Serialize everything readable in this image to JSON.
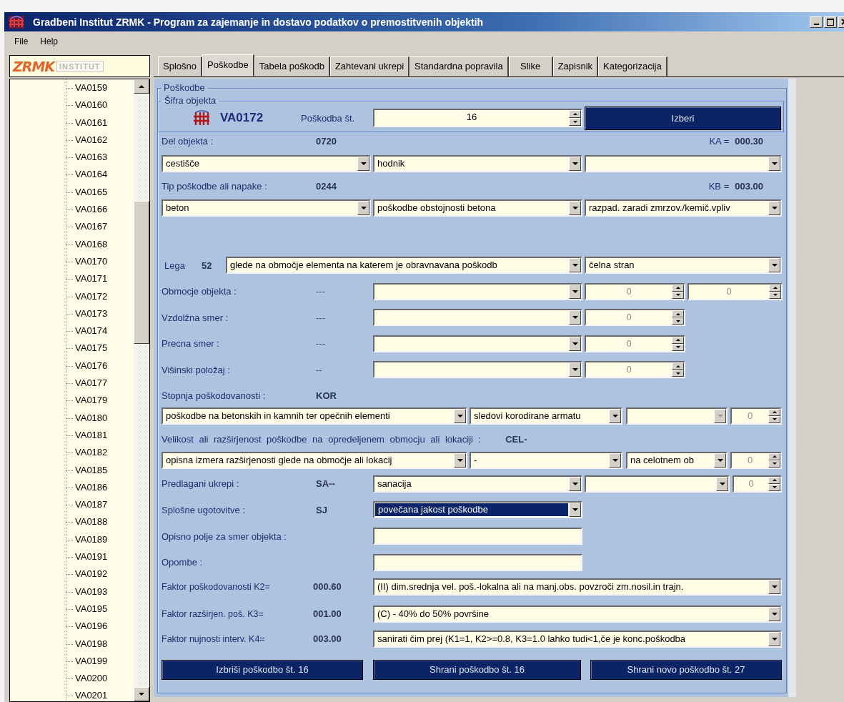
{
  "window": {
    "title": "Gradbeni Institut ZRMK - Program za zajemanje in dostavo podatkov o premostitvenih objektih"
  },
  "menu": [
    "File",
    "Help"
  ],
  "logo": {
    "mark": "ZRMK",
    "text": "INSTITUT"
  },
  "tree": {
    "items": [
      "VA0159",
      "VA0160",
      "VA0161",
      "VA0162",
      "VA0163",
      "VA0164",
      "VA0165",
      "VA0166",
      "VA0167",
      "VA0168",
      "VA0170",
      "VA0171",
      "VA0172",
      "VA0173",
      "VA0174",
      "VA0175",
      "VA0176",
      "VA0177",
      "VA0179",
      "VA0180",
      "VA0181",
      "VA0182",
      "VA0185",
      "VA0186",
      "VA0187",
      "VA0188",
      "VA0189",
      "VA0191",
      "VA0192",
      "VA0193",
      "VA0195",
      "VA0196",
      "VA0198",
      "VA0199",
      "VA0200",
      "VA0201"
    ]
  },
  "tabs": [
    {
      "label": "Splošno",
      "selected": false
    },
    {
      "label": "Poškodbe",
      "selected": true
    },
    {
      "label": "Tabela poškodb",
      "selected": false
    },
    {
      "label": "Zahtevani ukrepi",
      "selected": false
    },
    {
      "label": "Standardna popravila",
      "selected": false
    },
    {
      "label": "Slike",
      "selected": false
    },
    {
      "label": "Zapisnik",
      "selected": false
    },
    {
      "label": "Kategorizacija",
      "selected": false
    }
  ],
  "form": {
    "title": "Poškodbe",
    "object": {
      "title": "Šifra objekta",
      "code": "VA0172",
      "number_label": "Poškodba št.",
      "number": "16",
      "button": "Izberi"
    },
    "object_part": {
      "label": "Del objekta :",
      "code": "0720",
      "factor_label": "KA =",
      "factor_value": "000.30",
      "combos": [
        {
          "value": "cestišče"
        },
        {
          "value": "hodnik"
        }
      ]
    },
    "damage_type": {
      "label": "Tip poškodbe ali napake :",
      "code": "0244",
      "factor_label": "KB =",
      "factor_value": "003.00",
      "combos": [
        {
          "value": "beton"
        },
        {
          "value": "poškodbe obstojnosti betona"
        },
        {
          "value": "razpad. zaradi zmrzov./kemič.vpliv"
        }
      ]
    },
    "position": {
      "label": "Lega",
      "code": "52",
      "combos": [
        {
          "value": "glede na območje elementa na katerem je obravnavana poškodb"
        },
        {
          "value": "čelna stran"
        }
      ]
    },
    "location_rows": [
      {
        "label": "Obmocje objekta :",
        "code": "---",
        "spins": [
          "0",
          "0"
        ]
      },
      {
        "label": "Vzdolžna smer :",
        "code": "---",
        "spins": [
          "0"
        ]
      },
      {
        "label": "Precna smer :",
        "code": "---",
        "spins": [
          "0"
        ]
      },
      {
        "label": "Višinski položaj :",
        "code": "--",
        "spins": [
          "0"
        ]
      }
    ],
    "severity": {
      "label": "Stopnja poškodovanosti :",
      "code": "KOR",
      "combos": [
        {
          "value": "poškodbe na betonskih in kamnih ter opečnih elementi",
          "disabled": false
        },
        {
          "value": "sledovi korodirane armatu",
          "disabled": false
        },
        {
          "disabled": true
        }
      ],
      "spin": "0"
    },
    "extent": {
      "label": "Velikost ali razširjenost poškodbe na opredeljenem obmocju ali lokaciji :",
      "code": "CEL-",
      "combos": [
        {
          "value": "opisna izmera razširjenosti glede na območje ali lokacij",
          "disabled": false
        },
        {
          "value": "-",
          "disabled": false
        },
        {
          "value": "na celotnem ob",
          "disabled": false
        }
      ],
      "spin": "0"
    },
    "measures": {
      "label": "Predlagani ukrepi :",
      "code": "SA--",
      "combos": [
        {
          "value": "sanacija"
        }
      ],
      "spin": "0"
    },
    "findings": {
      "label": "Splošne ugotovitve :",
      "code": "SJ",
      "combo": {
        "value": "povečana jakost poškodbe",
        "highlighted": true
      }
    },
    "text_fields": [
      {
        "label": "Opisno polje za smer objekta :"
      },
      {
        "label": "Opombe :"
      }
    ],
    "factors": [
      {
        "label": "Faktor poškodovanosti K2=",
        "value": "000.60",
        "combo": "(II)   dim.srednja vel. poš.-lokalna ali na manj.obs. povzroči zm.nosil.in trajn."
      },
      {
        "label": "Faktor razširjen.  poš.   K3=",
        "value": "001.00",
        "combo": "(C) - 40% do 50% površine"
      },
      {
        "label": "Faktor nujnosti interv.   K4=",
        "value": "003.00",
        "combo": "sanirati čim prej (K1=1, K2>=0.8, K3=1.0 lahko tudi<1,če je konc.poškodba"
      }
    ],
    "buttons": [
      "Izbriši poškodbo št. 16",
      "Shrani poškodbo št. 16",
      "Shrani novo poškodbo št. 27"
    ]
  }
}
